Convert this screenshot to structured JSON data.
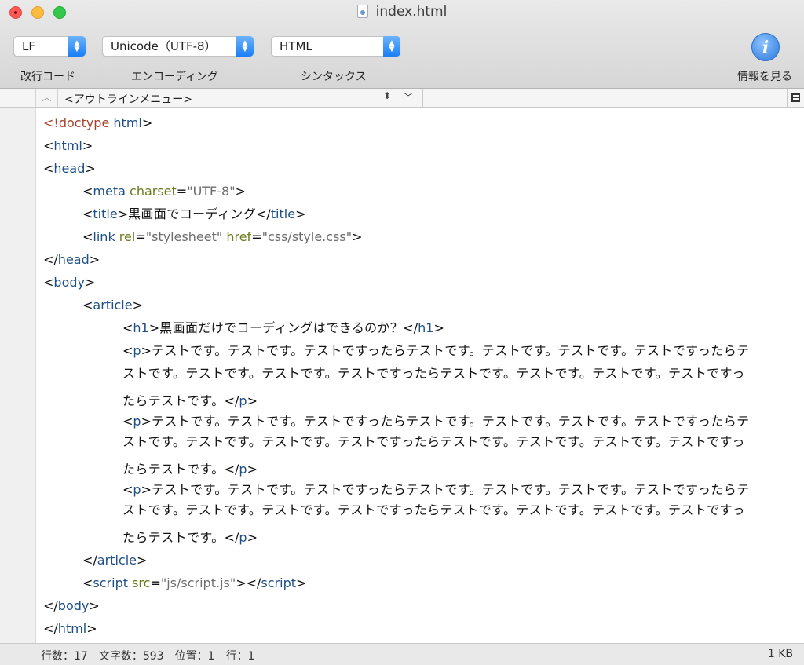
{
  "window": {
    "title": "index.html"
  },
  "toolbar": {
    "line_ending": {
      "value": "LF",
      "label": "改行コード"
    },
    "encoding": {
      "value": "Unicode（UTF-8）",
      "label": "エンコーディング"
    },
    "syntax": {
      "value": "HTML",
      "label": "シンタックス"
    },
    "info": {
      "glyph": "i",
      "label": "情報を見る"
    }
  },
  "outline": {
    "menu": "<アウトラインメニュー>"
  },
  "code": {
    "l1": {
      "lt": "<",
      "doctype": "!doctype",
      "rest": "html",
      "gt": ">"
    },
    "l2": "html",
    "l3": "head",
    "meta": {
      "tag": "meta",
      "attr": "charset",
      "eq": "=",
      "val": "\"UTF-8\""
    },
    "title": {
      "tag": "title",
      "text": "黒画面でコーディング"
    },
    "link": {
      "tag": "link",
      "attr1": "rel",
      "val1": "\"stylesheet\"",
      "attr2": "href",
      "val2": "\"css/style.css\""
    },
    "head_close": "head",
    "body_open": "body",
    "article_open": "article",
    "h1": {
      "tag": "h1",
      "text": "黒画面だけでコーディングはできるのか？"
    },
    "p_tag": "p",
    "p_line1": "テストです。テストです。テストですったらテストです。テストです。テストです。テストですったらテ",
    "p_line2": "ストです。テストです。テストです。テストですったらテストです。テストです。テストです。テストですっ",
    "p_line3": "たらテストです。",
    "article_close": "article",
    "script": {
      "tag": "script",
      "attr": "src",
      "val": "\"js/script.js\""
    },
    "body_close": "body",
    "html_close": "html"
  },
  "status": {
    "lines": "行数：17",
    "chars": "文字数：593",
    "position": "位置：1",
    "row": "行：1",
    "size": "1 KB"
  }
}
